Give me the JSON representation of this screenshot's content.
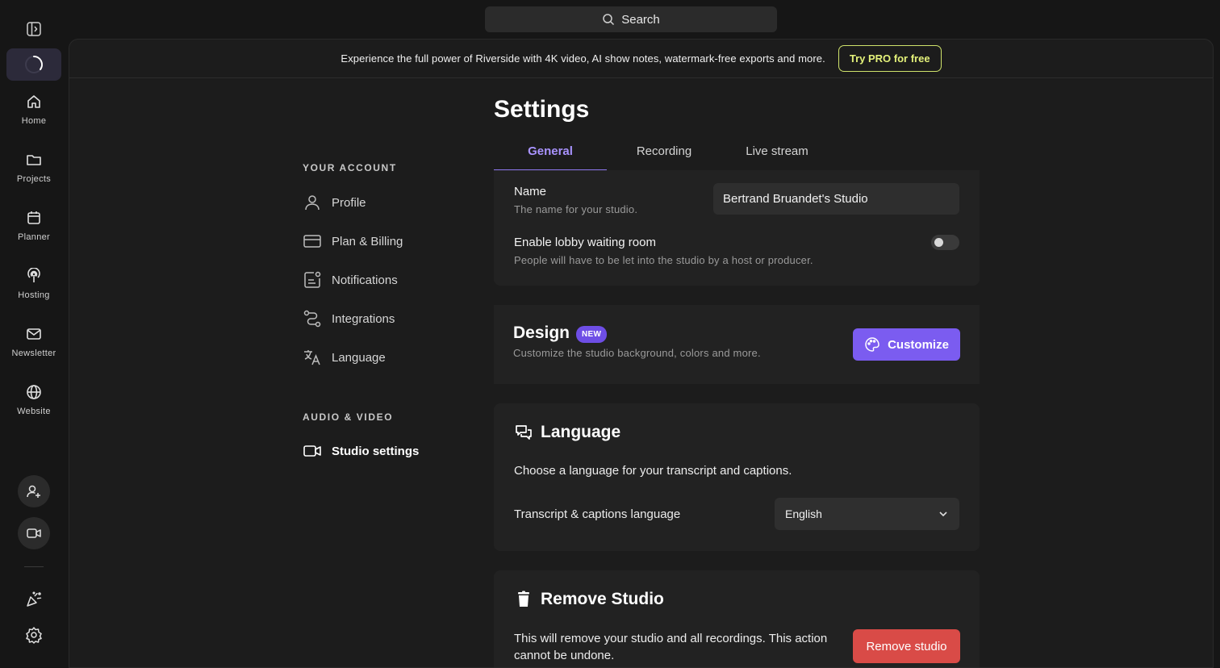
{
  "search": {
    "label": "Search"
  },
  "rail": {
    "items": [
      {
        "label": "Home",
        "icon": "home-icon"
      },
      {
        "label": "Projects",
        "icon": "folder-icon"
      },
      {
        "label": "Planner",
        "icon": "calendar-icon"
      },
      {
        "label": "Hosting",
        "icon": "podcast-icon"
      },
      {
        "label": "Newsletter",
        "icon": "mail-icon"
      },
      {
        "label": "Website",
        "icon": "globe-icon"
      }
    ]
  },
  "banner": {
    "text": "Experience the full power of Riverside with 4K video, AI show notes, watermark-free exports and more.",
    "cta": "Try PRO for free"
  },
  "settings_nav": {
    "account_heading": "YOUR ACCOUNT",
    "account_items": [
      "Profile",
      "Plan & Billing",
      "Notifications",
      "Integrations",
      "Language"
    ],
    "av_heading": "AUDIO & VIDEO",
    "av_items": [
      "Studio settings"
    ]
  },
  "page": {
    "title": "Settings",
    "tabs": [
      "General",
      "Recording",
      "Live stream"
    ],
    "active_tab": "General"
  },
  "general": {
    "name_label": "Name",
    "name_sub": "The name for your studio.",
    "name_value": "Bertrand Bruandet's Studio",
    "lobby_label": "Enable lobby waiting room",
    "lobby_sub": "People will have to be let into the studio by a host or producer.",
    "lobby_enabled": false
  },
  "design": {
    "title": "Design",
    "badge": "NEW",
    "sub": "Customize the studio background, colors and more.",
    "button": "Customize"
  },
  "language": {
    "title": "Language",
    "desc": "Choose a language for your transcript and captions.",
    "field_label": "Transcript & captions language",
    "selected": "English"
  },
  "remove": {
    "title": "Remove Studio",
    "desc": "This will remove your studio and all recordings. This action cannot be undone.",
    "button": "Remove studio"
  },
  "colors": {
    "accent": "#7b5cf0",
    "tab_active": "#a993ff",
    "danger": "#d94b47",
    "pro": "#e4f27a"
  }
}
